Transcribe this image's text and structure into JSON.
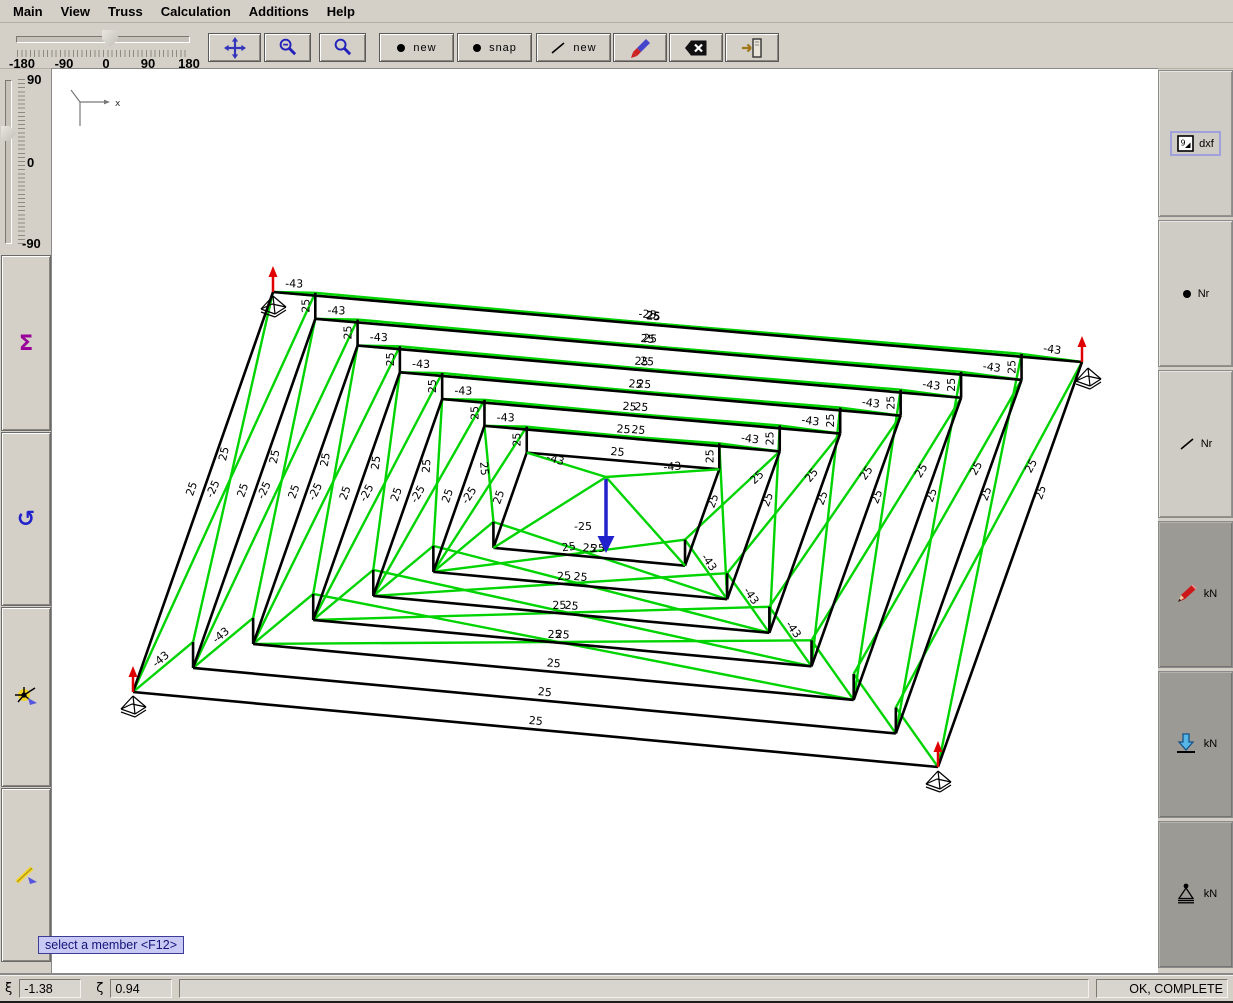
{
  "menu": {
    "items": [
      {
        "label": "Main"
      },
      {
        "label": "View"
      },
      {
        "label": "Truss"
      },
      {
        "label": "Calculation"
      },
      {
        "label": "Additions"
      },
      {
        "label": "Help"
      }
    ]
  },
  "toolbar": {
    "rotation_slider": {
      "tick_labels": [
        "-180",
        "-90",
        "0",
        "90",
        "180"
      ]
    },
    "buttons": [
      {
        "icon": "pan-icon"
      },
      {
        "icon": "zoom-out-icon"
      },
      {
        "icon": "zoom-in-icon"
      },
      {
        "icon": "node-dot-icon",
        "label": "new"
      },
      {
        "icon": "node-dot-icon",
        "label": "snap"
      },
      {
        "icon": "member-line-icon",
        "label": "new"
      },
      {
        "icon": "pen-icon"
      },
      {
        "icon": "delete-icon"
      },
      {
        "icon": "exit-icon"
      }
    ]
  },
  "left_panel": {
    "elevation_slider": {
      "tick_labels": [
        "90",
        "0",
        "-90"
      ]
    },
    "buttons": [
      {
        "icon": "sum-icon",
        "glyph": "Σ"
      },
      {
        "icon": "rotate-icon",
        "glyph": "↺"
      },
      {
        "icon": "select-node-icon"
      },
      {
        "icon": "select-member-icon"
      }
    ]
  },
  "right_panel": {
    "buttons": [
      {
        "icon": "dxf-export-icon",
        "label": "dxf",
        "icon_text": "9"
      },
      {
        "icon": "node-number-icon",
        "label": "Nr"
      },
      {
        "icon": "member-number-icon",
        "label": "Nr"
      },
      {
        "icon": "pencil-icon",
        "label": "kN"
      },
      {
        "icon": "load-arrow-icon",
        "label": "kN"
      },
      {
        "icon": "support-icon",
        "label": "kN"
      }
    ]
  },
  "tooltip": {
    "text": "select a member <F12>"
  },
  "statusbar": {
    "xi_symbol": "ξ",
    "xi_value": "-1.38",
    "zeta_symbol": "ζ",
    "zeta_value": "0.94",
    "message": "OK, COMPLETE"
  },
  "drawing": {
    "axis_label": "x",
    "rings": 7,
    "member_force_labels": {
      "chord": "25",
      "post": "25",
      "corner_diagonal": "-43",
      "face_diagonal_a": "25",
      "face_diagonal_b": "-25",
      "apex_diagonal": "-43",
      "center_a": "-25",
      "center_b": "25"
    },
    "colors": {
      "chord": "#000000",
      "diagonal": "#00d400",
      "load_arrow": "#2222cc",
      "reaction_arrow": "#e00000",
      "label_text": "#000000"
    }
  }
}
